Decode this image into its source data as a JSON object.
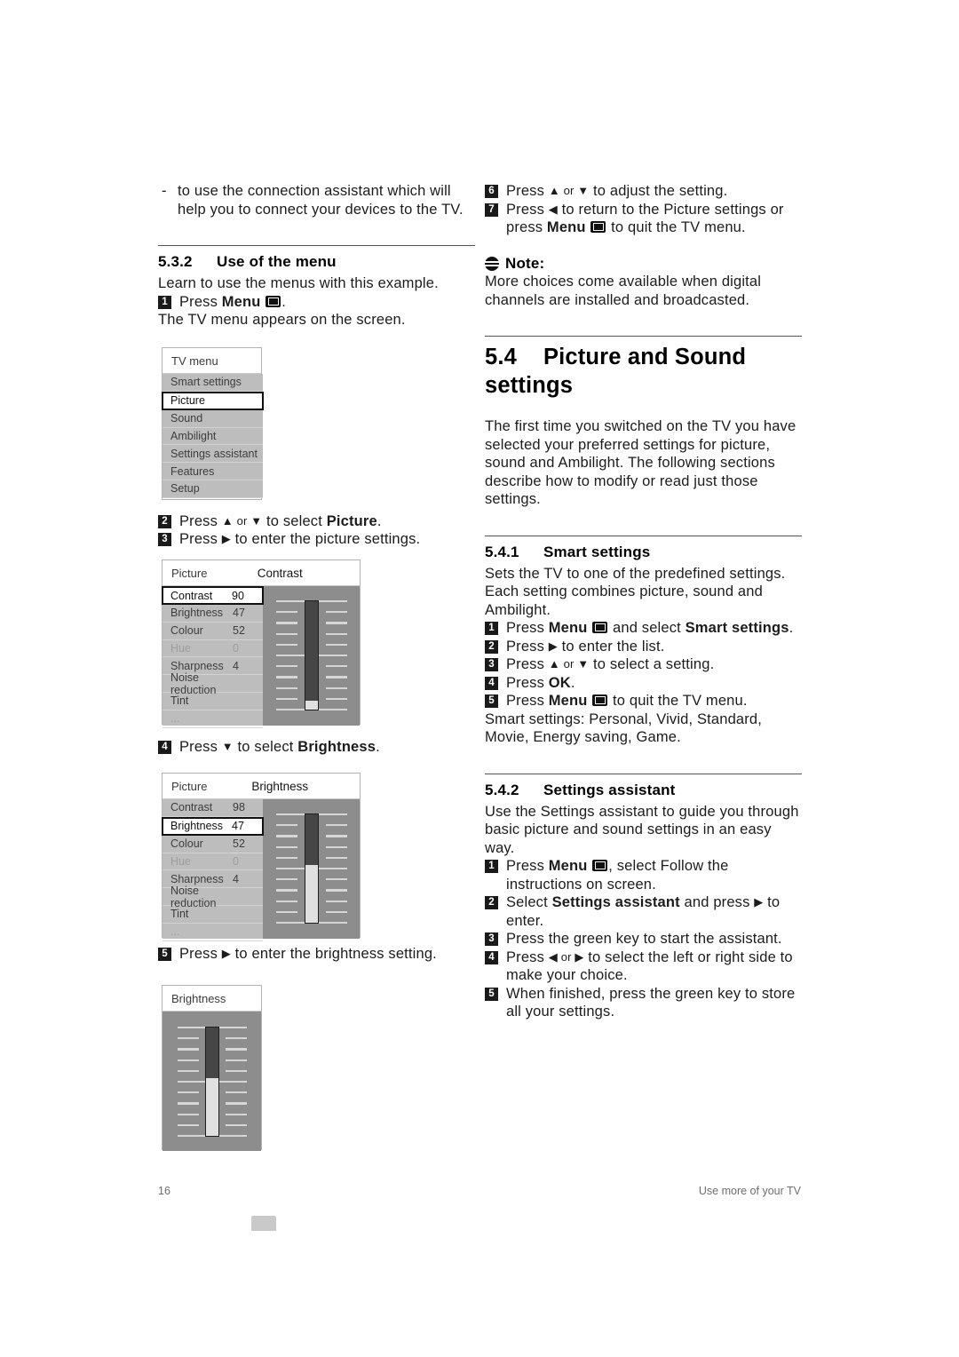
{
  "page": {
    "number": "16",
    "footer_right": "Use more of your TV"
  },
  "left_column": {
    "bullet": {
      "dash": "-",
      "text": "to use the connection assistant which will help you to connect your devices to the TV."
    },
    "section_532": {
      "number": "5.3.2",
      "title": "Use of the menu",
      "intro": "Learn to use the menus with this example.",
      "step1_pre": "Press ",
      "step1_bold": "Menu",
      "step1_post": ".",
      "step1_num": "1",
      "after_step1": "The TV menu appears on the screen.",
      "step2_num": "2",
      "step2_pre": "Press ",
      "step2_arrows": "▲ or ▼",
      "step2_mid": " to select ",
      "step2_bold": "Picture",
      "step2_post": ".",
      "step3_num": "3",
      "step3_pre": "Press ",
      "step3_arrow": "▶",
      "step3_post": " to enter the picture settings.",
      "step4_num": "4",
      "step4_pre": "Press ",
      "step4_arrow": "▼",
      "step4_mid": " to select ",
      "step4_bold": "Brightness",
      "step4_post": ".",
      "step5_num": "5",
      "step5_pre": "Press ",
      "step5_arrow": "▶",
      "step5_post": " to enter the brightness setting."
    }
  },
  "right_column": {
    "step6_num": "6",
    "step6_pre": "Press ",
    "step6_arrows": "▲ or ▼",
    "step6_post": " to adjust the setting.",
    "step7_num": "7",
    "step7_pre": "Press ",
    "step7_arrow": "◀",
    "step7_mid": " to return to the Picture settings or press ",
    "step7_bold": "Menu",
    "step7_post": " to quit the TV menu.",
    "note": {
      "label": "Note",
      "colon": ":",
      "text": "More choices come available when digital channels are installed and broadcasted."
    },
    "section_54": {
      "number": "5.4",
      "title": "Picture and Sound settings",
      "intro": "The first time you switched on the TV you have selected your preferred settings for picture, sound and Ambilight. The following sections describe how to modify or read just those settings."
    },
    "section_541": {
      "number": "5.4.1",
      "title": "Smart settings",
      "intro": "Sets the TV to one of the predefined settings. Each setting combines picture, sound and Ambilight.",
      "step1_num": "1",
      "step1_pre": "Press ",
      "step1_bold": "Menu",
      "step1_mid": " and select ",
      "step1_bold2": "Smart settings",
      "step1_post": ".",
      "step2_num": "2",
      "step2_pre": "Press ",
      "step2_arrow": "▶",
      "step2_post": " to enter the list.",
      "step3_num": "3",
      "step3_pre": "Press ",
      "step3_arrows": "▲ or ▼",
      "step3_post": " to select a setting.",
      "step4_num": "4",
      "step4_pre": "Press ",
      "step4_bold": "OK",
      "step4_post": ".",
      "step5_num": "5",
      "step5_pre": "Press ",
      "step5_bold": "Menu",
      "step5_post": " to quit the TV menu.",
      "outro": "Smart settings: Personal, Vivid, Standard, Movie, Energy saving, Game."
    },
    "section_542": {
      "number": "5.4.2",
      "title": "Settings assistant",
      "intro": "Use the Settings assistant to guide you through basic picture and sound settings in an easy way.",
      "step1_num": "1",
      "step1_pre": "Press ",
      "step1_bold": "Menu",
      "step1_post": ", select Follow the instructions on screen.",
      "step2_num": "2",
      "step2_pre": "Select ",
      "step2_bold": "Settings assistant",
      "step2_mid": " and press ",
      "step2_arrow": "▶",
      "step2_post": " to enter.",
      "step3_num": "3",
      "step3_text": "Press the green key to start the assistant.",
      "step4_num": "4",
      "step4_pre": "Press ",
      "step4_arrows": "◀ or ▶",
      "step4_post": " to select the left or right side to make your choice.",
      "step5_num": "5",
      "step5_text": "When finished, press the green key to store all your settings."
    }
  },
  "mockups": {
    "tv_menu": {
      "title": "TV menu",
      "items": [
        {
          "label": "Smart settings",
          "selected": false,
          "dim": false
        },
        {
          "label": "Picture",
          "selected": true,
          "dim": false
        },
        {
          "label": "Sound",
          "selected": false,
          "dim": false
        },
        {
          "label": "Ambilight",
          "selected": false,
          "dim": false
        },
        {
          "label": "Settings assistant",
          "selected": false,
          "dim": false
        },
        {
          "label": "Features",
          "selected": false,
          "dim": false
        },
        {
          "label": "Setup",
          "selected": false,
          "dim": false
        }
      ]
    },
    "picture_contrast": {
      "title_left": "Picture",
      "title_right": "Contrast",
      "items": [
        {
          "label": "Contrast",
          "value": "90",
          "selected": true,
          "dim": false
        },
        {
          "label": "Brightness",
          "value": "47",
          "selected": false,
          "dim": false
        },
        {
          "label": "Colour",
          "value": "52",
          "selected": false,
          "dim": false
        },
        {
          "label": "Hue",
          "value": "0",
          "selected": false,
          "dim": true
        },
        {
          "label": "Sharpness",
          "value": "4",
          "selected": false,
          "dim": false
        },
        {
          "label": "Noise reduction",
          "value": "",
          "selected": false,
          "dim": false
        },
        {
          "label": "Tint",
          "value": "",
          "selected": false,
          "dim": false
        },
        {
          "label": "...",
          "value": "",
          "selected": false,
          "dim": true
        }
      ],
      "slider_percent": 8
    },
    "picture_brightness": {
      "title_left": "Picture",
      "title_right": "Brightness",
      "items": [
        {
          "label": "Contrast",
          "value": "98",
          "selected": false,
          "dim": false
        },
        {
          "label": "Brightness",
          "value": "47",
          "selected": true,
          "dim": false
        },
        {
          "label": "Colour",
          "value": "52",
          "selected": false,
          "dim": false
        },
        {
          "label": "Hue",
          "value": "0",
          "selected": false,
          "dim": true
        },
        {
          "label": "Sharpness",
          "value": "4",
          "selected": false,
          "dim": false
        },
        {
          "label": "Noise reduction",
          "value": "",
          "selected": false,
          "dim": false
        },
        {
          "label": "Tint",
          "value": "",
          "selected": false,
          "dim": false
        },
        {
          "label": "...",
          "value": "",
          "selected": false,
          "dim": true
        }
      ],
      "slider_percent": 53
    },
    "brightness_only": {
      "title": "Brightness",
      "slider_percent": 53
    }
  }
}
